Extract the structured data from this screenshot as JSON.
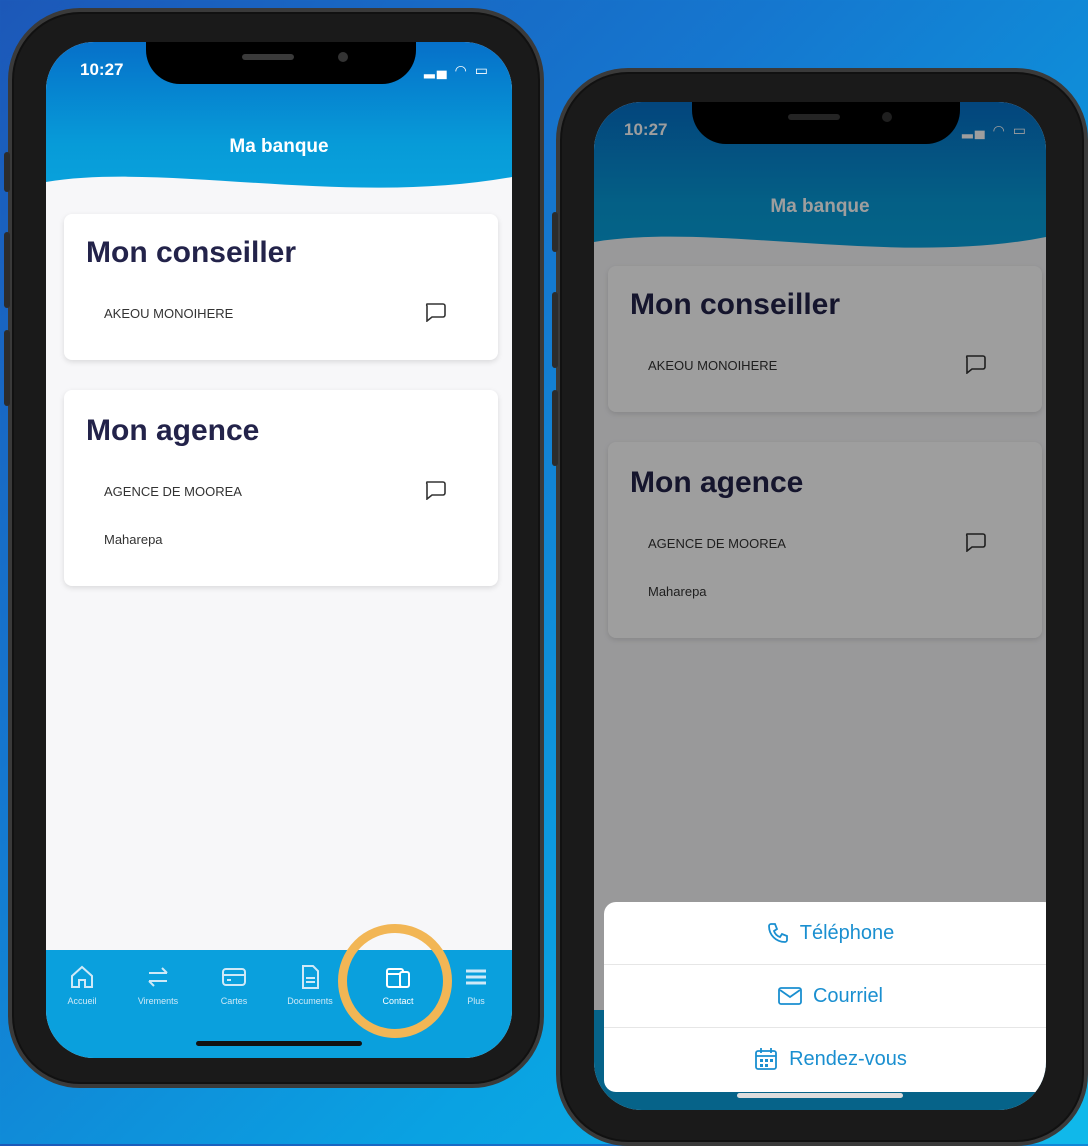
{
  "status": {
    "time": "10:27"
  },
  "header": {
    "title": "Ma banque"
  },
  "conseiller": {
    "heading": "Mon conseiller",
    "name": "AKEOU MONOIHERE"
  },
  "agence": {
    "heading": "Mon agence",
    "name": "AGENCE DE MOOREA",
    "location": "Maharepa"
  },
  "tabs": [
    {
      "label": "Accueil",
      "icon": "home-icon"
    },
    {
      "label": "Virements",
      "icon": "transfer-icon"
    },
    {
      "label": "Cartes",
      "icon": "card-icon"
    },
    {
      "label": "Documents",
      "icon": "document-icon"
    },
    {
      "label": "Contact",
      "icon": "calendar-phone-icon",
      "active": true
    },
    {
      "label": "Plus",
      "icon": "menu-icon"
    }
  ],
  "action_sheet": {
    "options": [
      {
        "label": "Téléphone",
        "icon": "phone-icon"
      },
      {
        "label": "Courriel",
        "icon": "mail-icon"
      },
      {
        "label": "Rendez-vous",
        "icon": "calendar-icon"
      }
    ]
  },
  "colors": {
    "accent": "#0aa0dd",
    "highlight_ring": "#f2b655",
    "heading": "#23234a",
    "sheet_text": "#1a8fd0"
  }
}
